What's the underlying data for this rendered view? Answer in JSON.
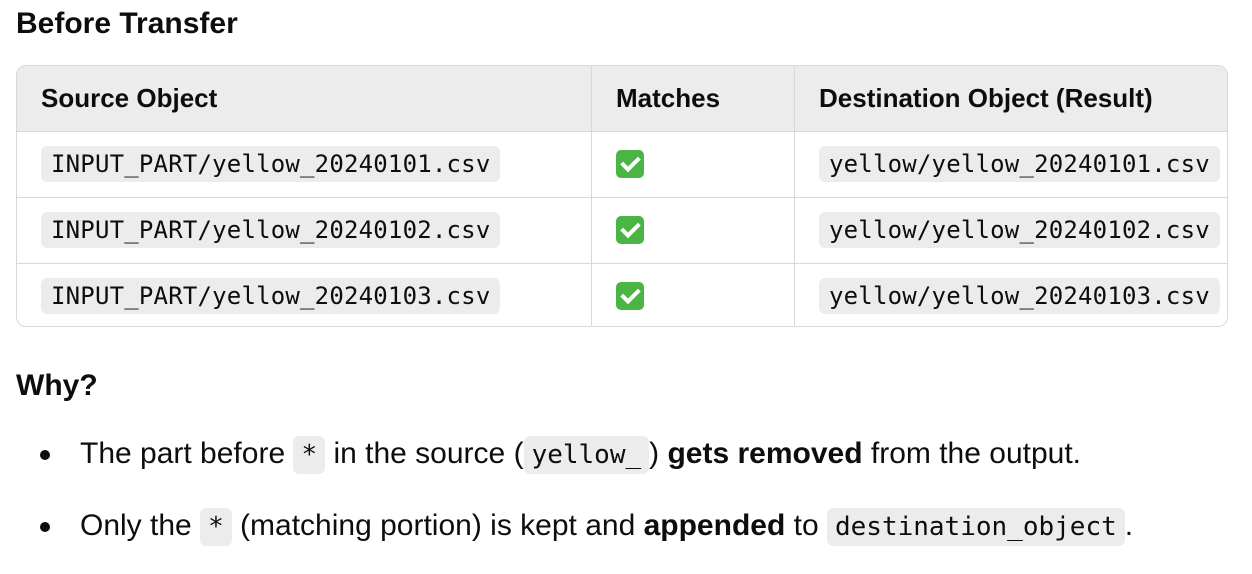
{
  "section_title": "Before Transfer",
  "table": {
    "headers": [
      "Source Object",
      "Matches",
      "Destination Object (Result)"
    ],
    "rows": [
      {
        "source": "INPUT_PART/yellow_20240101.csv",
        "match_icon": "green-check-icon",
        "destination": "yellow/yellow_20240101.csv"
      },
      {
        "source": "INPUT_PART/yellow_20240102.csv",
        "match_icon": "green-check-icon",
        "destination": "yellow/yellow_20240102.csv"
      },
      {
        "source": "INPUT_PART/yellow_20240103.csv",
        "match_icon": "green-check-icon",
        "destination": "yellow/yellow_20240103.csv"
      }
    ]
  },
  "why_title": "Why?",
  "bullets": [
    {
      "t1": "The part before ",
      "code1": "*",
      "t2": " in the source (",
      "code2": "yellow_",
      "t3": ") ",
      "bold": "gets removed",
      "t4": " from the output."
    },
    {
      "t1": "Only the ",
      "code1": "*",
      "t2": " (matching portion) is kept and ",
      "bold": "appended",
      "t3": " to ",
      "code2": "destination_object",
      "t4": "."
    }
  ],
  "colors": {
    "check_green": "#4bb543",
    "header_bg": "#ececec",
    "code_bg": "#ececec"
  }
}
